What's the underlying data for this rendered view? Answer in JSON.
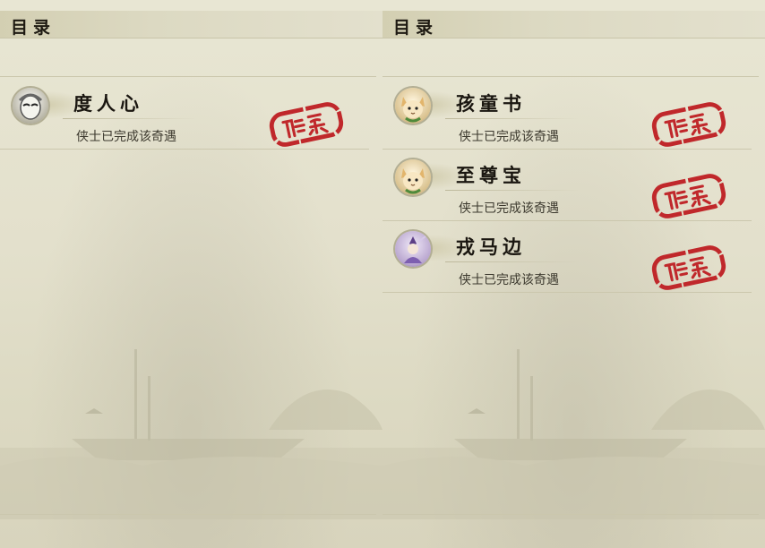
{
  "left_panel": {
    "title": "目录",
    "entries": [
      {
        "name": "度人心",
        "status": "侠士已完成该奇遇",
        "icon": "mask-icon"
      }
    ]
  },
  "right_panel": {
    "title": "目录",
    "entries": [
      {
        "name": "孩童书",
        "status": "侠士已完成该奇遇",
        "icon": "cat-icon"
      },
      {
        "name": "至尊宝",
        "status": "侠士已完成该奇遇",
        "icon": "cat-icon"
      },
      {
        "name": "戎马边",
        "status": "侠士已完成该奇遇",
        "icon": "warrior-icon"
      }
    ]
  },
  "colors": {
    "stamp_red": "#c0282b",
    "title_ink": "#1e1a12",
    "paper": "#e2dfcb"
  }
}
